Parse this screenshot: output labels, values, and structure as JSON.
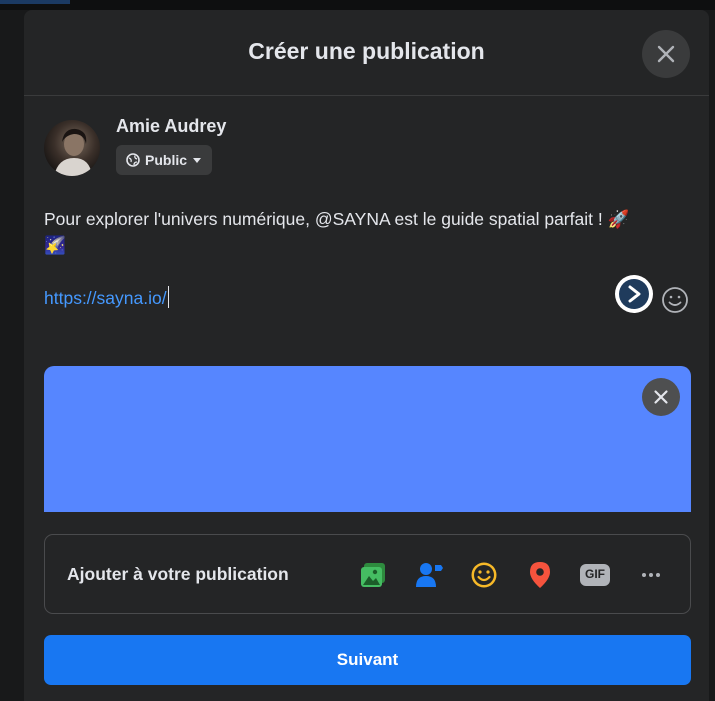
{
  "dialog": {
    "title": "Créer une publication"
  },
  "author": {
    "name": "Amie Audrey",
    "privacy_label": "Public"
  },
  "post": {
    "text": "Pour explorer l'univers numérique, @SAYNA est le guide spatial parfait ! 🚀 🌠",
    "link": "https://sayna.io/"
  },
  "add_to_post": {
    "label": "Ajouter à votre publication",
    "icons": [
      "photo-video-icon",
      "tag-people-icon",
      "feeling-activity-icon",
      "check-in-location-icon",
      "gif-icon",
      "more-icon"
    ],
    "gif_text": "GIF"
  },
  "actions": {
    "next_label": "Suivant"
  },
  "colors": {
    "dialog_bg": "#242526",
    "primary_button": "#1877f2",
    "link_preview": "#5686ff",
    "link_text": "#4599ff"
  }
}
